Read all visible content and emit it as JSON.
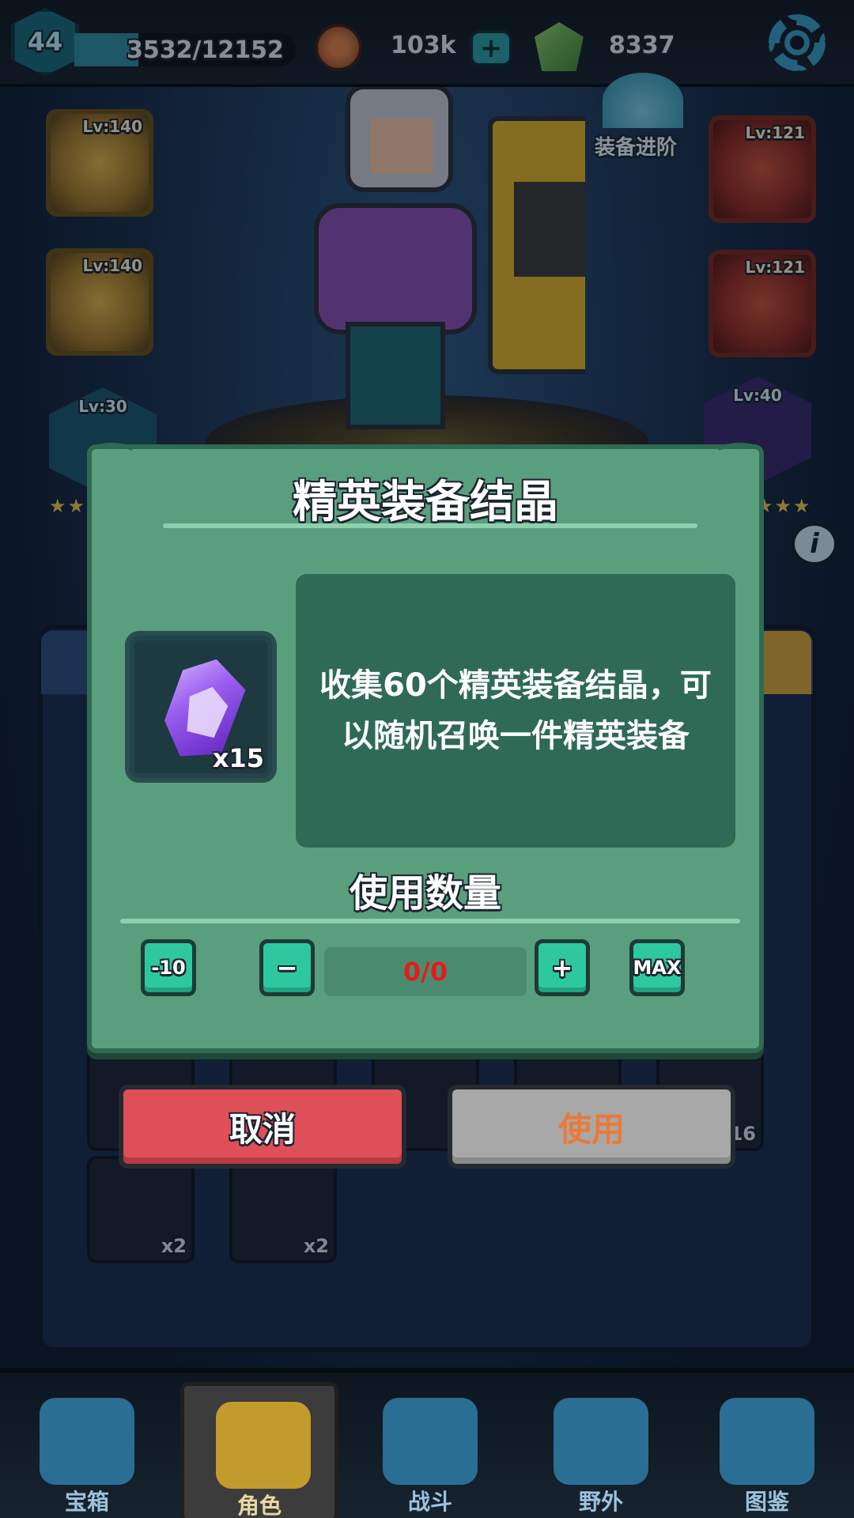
{
  "top_bar": {
    "player_level": "44",
    "xp_text": "3532/12152",
    "xp_progress": 0.29,
    "coins": "103k",
    "gems": "8337"
  },
  "equipment": {
    "upgrade_label": "装备进阶",
    "slots": [
      {
        "level": "Lv:140",
        "rarity": "gold"
      },
      {
        "level": "Lv:140",
        "rarity": "gold"
      },
      {
        "level": "Lv:121",
        "rarity": "red"
      },
      {
        "level": "Lv:121",
        "rarity": "red"
      }
    ],
    "pets": [
      {
        "level": "Lv:30"
      },
      {
        "level": "Lv:40"
      }
    ]
  },
  "inventory": {
    "counts": [
      "x2",
      "x2",
      "16"
    ]
  },
  "modal": {
    "title": "精英装备结晶",
    "item_count": "x15",
    "description": "收集60个精英装备结晶，可以随机召唤一件精英装备",
    "quantity_label": "使用数量",
    "btn_minus10": "-10",
    "btn_minus": "−",
    "quantity_value": "0/0",
    "btn_plus": "+",
    "btn_max": "MAX"
  },
  "actions": {
    "cancel": "取消",
    "use": "使用"
  },
  "nav": {
    "tabs": [
      {
        "label": "宝箱",
        "active": false
      },
      {
        "label": "角色",
        "active": true
      },
      {
        "label": "战斗",
        "active": false
      },
      {
        "label": "野外",
        "active": false
      },
      {
        "label": "图鉴",
        "active": false
      }
    ]
  },
  "colors": {
    "modal_bg": "#5a9f7d",
    "cancel": "#df4f58",
    "use_disabled": "#a8a8a8",
    "qty_value": "#e51b1b",
    "stepper": "#2ec8a0"
  }
}
